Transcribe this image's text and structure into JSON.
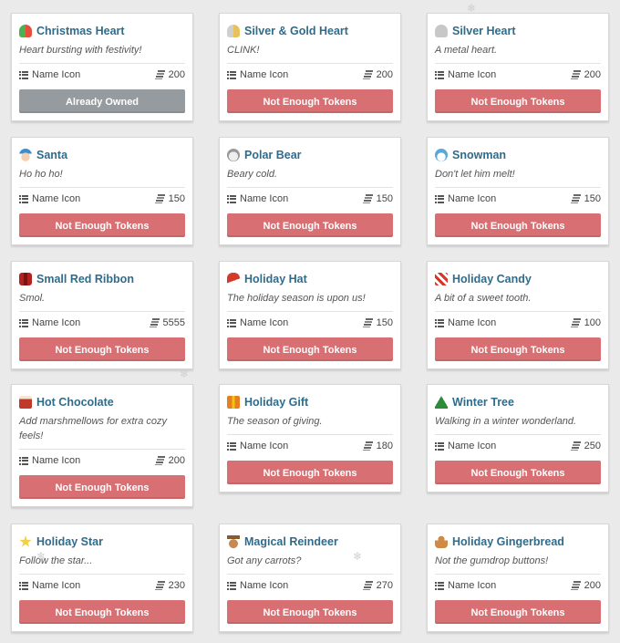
{
  "meta_label": "Name Icon",
  "colors": {
    "title": "#2e6c8c",
    "button_red": "#d86f72",
    "button_gray": "#969b9f",
    "background": "#eaeaea"
  },
  "cards": [
    {
      "title": "Christmas Heart",
      "description": "Heart bursting with festivity!",
      "price": "200",
      "button": "Already Owned",
      "icon": "christmas-heart-icon"
    },
    {
      "title": "Silver & Gold Heart",
      "description": "CLINK!",
      "price": "200",
      "button": "Not Enough Tokens",
      "icon": "silver-gold-heart-icon"
    },
    {
      "title": "Silver Heart",
      "description": "A metal heart.",
      "price": "200",
      "button": "Not Enough Tokens",
      "icon": "silver-heart-icon"
    },
    {
      "title": "Santa",
      "description": "Ho ho ho!",
      "price": "150",
      "button": "Not Enough Tokens",
      "icon": "santa-icon"
    },
    {
      "title": "Polar Bear",
      "description": "Beary cold.",
      "price": "150",
      "button": "Not Enough Tokens",
      "icon": "polar-bear-icon"
    },
    {
      "title": "Snowman",
      "description": "Don't let him melt!",
      "price": "150",
      "button": "Not Enough Tokens",
      "icon": "snowman-icon"
    },
    {
      "title": "Small Red Ribbon",
      "description": "Smol.",
      "price": "5555",
      "button": "Not Enough Tokens",
      "icon": "ribbon-icon"
    },
    {
      "title": "Holiday Hat",
      "description": "The holiday season is upon us!",
      "price": "150",
      "button": "Not Enough Tokens",
      "icon": "santa-hat-icon"
    },
    {
      "title": "Holiday Candy",
      "description": "A bit of a sweet tooth.",
      "price": "100",
      "button": "Not Enough Tokens",
      "icon": "candy-cane-icon"
    },
    {
      "title": "Hot Chocolate",
      "description": "Add marshmellows for extra cozy feels!",
      "price": "200",
      "button": "Not Enough Tokens",
      "icon": "hot-chocolate-icon"
    },
    {
      "title": "Holiday Gift",
      "description": "The season of giving.",
      "price": "180",
      "button": "Not Enough Tokens",
      "icon": "gift-icon"
    },
    {
      "title": "Winter Tree",
      "description": "Walking in a winter wonderland.",
      "price": "250",
      "button": "Not Enough Tokens",
      "icon": "tree-icon"
    },
    {
      "title": "Holiday Star",
      "description": "Follow the star...",
      "price": "230",
      "button": "Not Enough Tokens",
      "icon": "star-icon"
    },
    {
      "title": "Magical Reindeer",
      "description": "Got any carrots?",
      "price": "270",
      "button": "Not Enough Tokens",
      "icon": "reindeer-icon"
    },
    {
      "title": "Holiday Gingerbread",
      "description": "Not the gumdrop buttons!",
      "price": "200",
      "button": "Not Enough Tokens",
      "icon": "gingerbread-icon"
    }
  ]
}
